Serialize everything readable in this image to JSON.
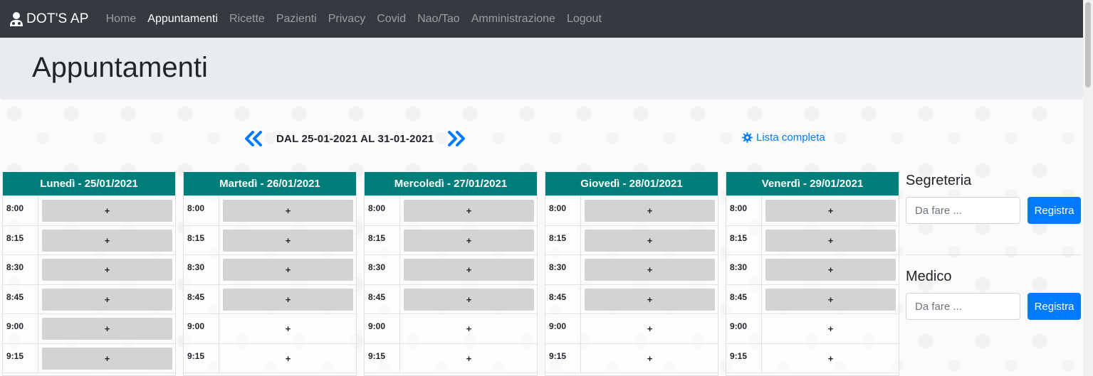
{
  "navbar": {
    "brand": "DOT'S AP",
    "items": [
      {
        "label": "Home",
        "active": false
      },
      {
        "label": "Appuntamenti",
        "active": true
      },
      {
        "label": "Ricette",
        "active": false
      },
      {
        "label": "Pazienti",
        "active": false
      },
      {
        "label": "Privacy",
        "active": false
      },
      {
        "label": "Covid",
        "active": false
      },
      {
        "label": "Nao/Tao",
        "active": false
      },
      {
        "label": "Amministrazione",
        "active": false
      },
      {
        "label": "Logout",
        "active": false
      }
    ]
  },
  "page": {
    "title": "Appuntamenti"
  },
  "week": {
    "label": "DAL 25-01-2021 AL 31-01-2021",
    "prev_icon": "double-chevron-left-icon",
    "next_icon": "double-chevron-right-icon"
  },
  "lista": {
    "label": "Lista completa",
    "icon": "gear-icon"
  },
  "colors": {
    "navbar": "#343a40",
    "header": "#007e7a",
    "primary": "#007bff",
    "slot": "#d3d3d3",
    "jumbotron": "#e9ecef"
  },
  "days": [
    {
      "title": "Lunedì - 25/01/2021",
      "slots": [
        {
          "time": "8:00",
          "label": "+",
          "booked": true
        },
        {
          "time": "8:15",
          "label": "+",
          "booked": true
        },
        {
          "time": "8:30",
          "label": "+",
          "booked": true
        },
        {
          "time": "8:45",
          "label": "+",
          "booked": true
        },
        {
          "time": "9:00",
          "label": "+",
          "booked": true
        },
        {
          "time": "9:15",
          "label": "+",
          "booked": true
        }
      ]
    },
    {
      "title": "Martedì - 26/01/2021",
      "slots": [
        {
          "time": "8:00",
          "label": "+",
          "booked": true
        },
        {
          "time": "8:15",
          "label": "+",
          "booked": true
        },
        {
          "time": "8:30",
          "label": "+",
          "booked": true
        },
        {
          "time": "8:45",
          "label": "+",
          "booked": true
        },
        {
          "time": "9:00",
          "label": "+",
          "booked": false
        },
        {
          "time": "9:15",
          "label": "+",
          "booked": false
        }
      ]
    },
    {
      "title": "Mercoledì - 27/01/2021",
      "slots": [
        {
          "time": "8:00",
          "label": "+",
          "booked": true
        },
        {
          "time": "8:15",
          "label": "+",
          "booked": true
        },
        {
          "time": "8:30",
          "label": "+",
          "booked": true
        },
        {
          "time": "8:45",
          "label": "+",
          "booked": true
        },
        {
          "time": "9:00",
          "label": "+",
          "booked": false
        },
        {
          "time": "9:15",
          "label": "+",
          "booked": false
        }
      ]
    },
    {
      "title": "Giovedì - 28/01/2021",
      "slots": [
        {
          "time": "8:00",
          "label": "+",
          "booked": true
        },
        {
          "time": "8:15",
          "label": "+",
          "booked": true
        },
        {
          "time": "8:30",
          "label": "+",
          "booked": true
        },
        {
          "time": "8:45",
          "label": "+",
          "booked": true
        },
        {
          "time": "9:00",
          "label": "+",
          "booked": false
        },
        {
          "time": "9:15",
          "label": "+",
          "booked": false
        }
      ]
    },
    {
      "title": "Venerdì - 29/01/2021",
      "slots": [
        {
          "time": "8:00",
          "label": "+",
          "booked": true
        },
        {
          "time": "8:15",
          "label": "+",
          "booked": true
        },
        {
          "time": "8:30",
          "label": "+",
          "booked": true
        },
        {
          "time": "8:45",
          "label": "+",
          "booked": true
        },
        {
          "time": "9:00",
          "label": "+",
          "booked": false
        },
        {
          "time": "9:15",
          "label": "+",
          "booked": false
        }
      ]
    }
  ],
  "sidebar": {
    "segreteria": {
      "title": "Segreteria",
      "placeholder": "Da fare ...",
      "button": "Registra"
    },
    "medico": {
      "title": "Medico",
      "placeholder": "Da fare ...",
      "button": "Registra"
    }
  }
}
